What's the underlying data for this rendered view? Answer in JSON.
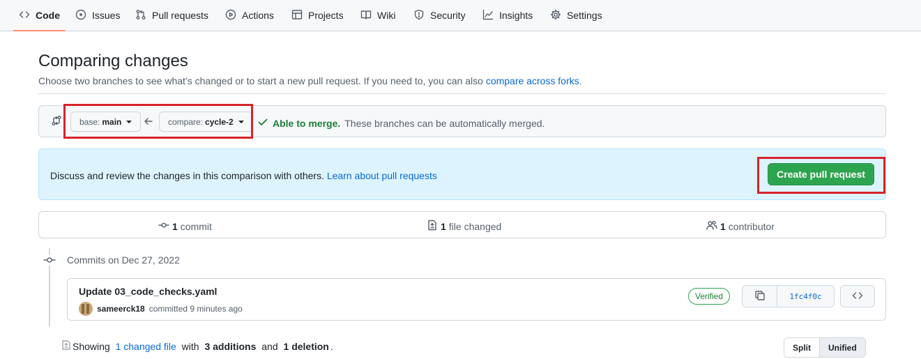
{
  "nav": {
    "tabs": [
      {
        "label": "Code",
        "icon": "code-icon",
        "active": true
      },
      {
        "label": "Issues",
        "icon": "issue-icon"
      },
      {
        "label": "Pull requests",
        "icon": "pull-request-icon"
      },
      {
        "label": "Actions",
        "icon": "play-icon"
      },
      {
        "label": "Projects",
        "icon": "table-icon"
      },
      {
        "label": "Wiki",
        "icon": "book-icon"
      },
      {
        "label": "Security",
        "icon": "shield-icon"
      },
      {
        "label": "Insights",
        "icon": "graph-icon"
      },
      {
        "label": "Settings",
        "icon": "gear-icon"
      }
    ]
  },
  "page": {
    "title": "Comparing changes",
    "subtitle": "Choose two branches to see what’s changed or to start a new pull request. If you need to, you can also",
    "subtitle_link": "compare across forks",
    "subtitle_end": "."
  },
  "compare": {
    "base_prefix": "base:",
    "base_branch": "main",
    "compare_prefix": "compare:",
    "compare_branch": "cycle-2",
    "merge_status": "Able to merge.",
    "merge_detail": "These branches can be automatically merged."
  },
  "banner": {
    "text": "Discuss and review the changes in this comparison with others.",
    "link": "Learn about pull requests",
    "button": "Create pull request"
  },
  "stats": {
    "commits_count": "1",
    "commits_label": "commit",
    "files_count": "1",
    "files_label": "file changed",
    "contributors_count": "1",
    "contributors_label": "contributor"
  },
  "commits": {
    "date_label": "Commits on Dec 27, 2022",
    "items": [
      {
        "message": "Update 03_code_checks.yaml",
        "author": "sameerck18",
        "action": "committed 9 minutes ago",
        "badge": "Verified",
        "sha": "1fc4f0c"
      }
    ]
  },
  "summary": {
    "showing": "Showing",
    "changed_link": "1 changed file",
    "with": "with",
    "additions": "3 additions",
    "and": "and",
    "deletions": "1 deletion",
    "end": "."
  },
  "view": {
    "split": "Split",
    "unified": "Unified",
    "selected": "Unified"
  },
  "colors": {
    "highlight": "#d8232a",
    "primary_button": "#2da44e",
    "banner_bg": "#ddf4ff",
    "link": "#0969da",
    "active_tab_underline": "#fd8c73"
  }
}
